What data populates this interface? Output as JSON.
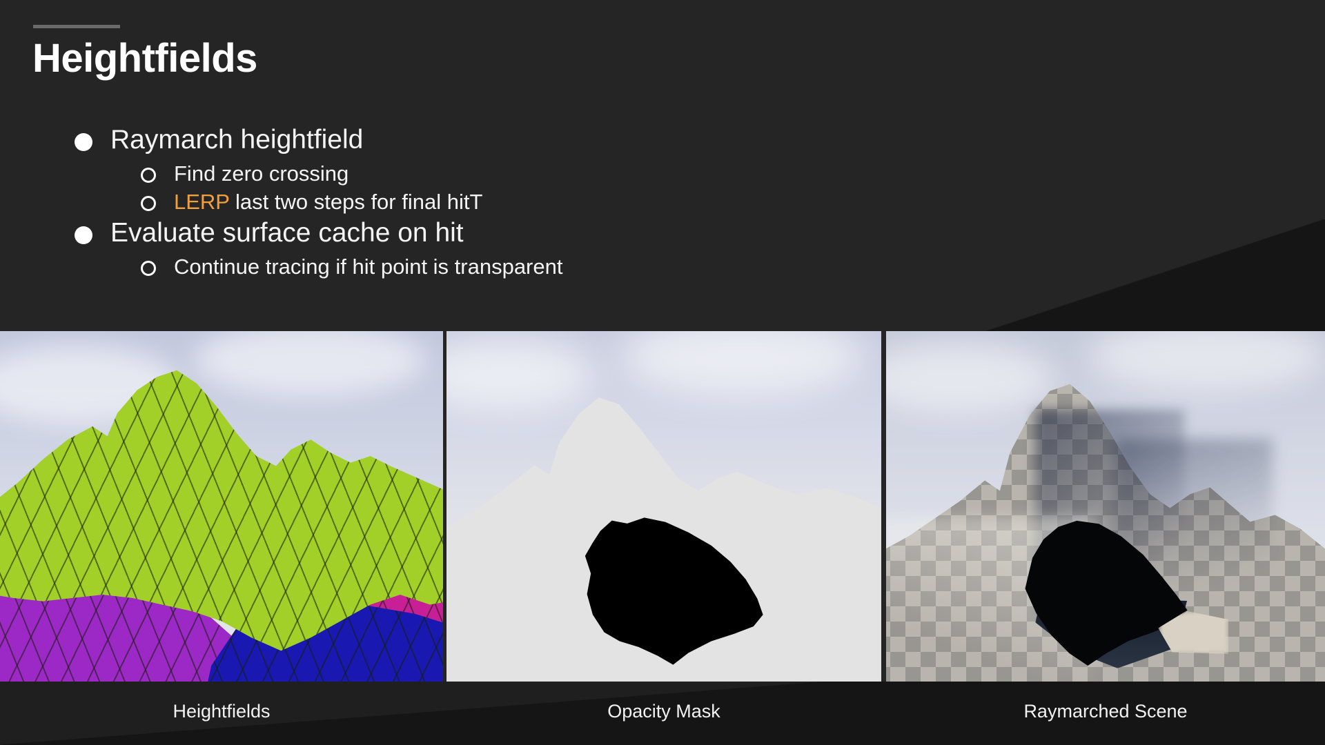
{
  "slide": {
    "title": "Heightfields",
    "accent_color": "#f0a03c",
    "background_color": "#252525",
    "text_color": "#f4f4f4"
  },
  "bullets": [
    {
      "level": 1,
      "marker": "filled-circle",
      "text": "Raymarch heightfield"
    },
    {
      "level": 2,
      "marker": "hollow-circle",
      "text": "Find zero crossing"
    },
    {
      "level": 2,
      "marker": "hollow-circle",
      "highlight": "LERP",
      "text": " last two steps for final hitT"
    },
    {
      "level": 1,
      "marker": "filled-circle",
      "text": "Evaluate surface cache on hit"
    },
    {
      "level": 2,
      "marker": "hollow-circle",
      "text": "Continue tracing if hit point is transparent"
    }
  ],
  "figures": [
    {
      "caption": "Heightfields",
      "description": "wireframe-heightfield-render",
      "colors": {
        "green": "#a2cf28",
        "magenta": "#c81e96",
        "purple": "#9c28c6",
        "blue": "#1919b2",
        "sky": "#cdd2e3"
      }
    },
    {
      "caption": "Opacity Mask",
      "description": "opacity-mask-render",
      "colors": {
        "silhouette": "#e3e3e3",
        "mask_hole": "#000000",
        "sky": "#d3d7e6"
      }
    },
    {
      "caption": "Raymarched Scene",
      "description": "raymarched-scene-render",
      "colors": {
        "terrain": "#b9b5ae",
        "cave": "#050607",
        "sky": "#d2d6e3"
      }
    }
  ]
}
